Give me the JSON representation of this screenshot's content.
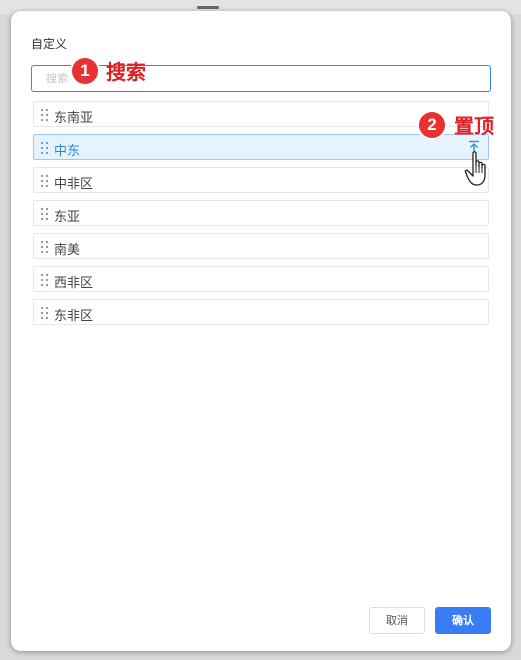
{
  "dialog": {
    "title": "自定义",
    "search": {
      "placeholder": "搜索",
      "value": ""
    },
    "items": [
      {
        "label": "东南亚",
        "active": false
      },
      {
        "label": "中东",
        "active": true
      },
      {
        "label": "中非区",
        "active": false
      },
      {
        "label": "东亚",
        "active": false
      },
      {
        "label": "南美",
        "active": false
      },
      {
        "label": "西非区",
        "active": false
      },
      {
        "label": "东非区",
        "active": false
      }
    ],
    "cancel_label": "取消",
    "confirm_label": "确认"
  },
  "annotations": {
    "step1": {
      "number": "1",
      "text": "搜索"
    },
    "step2": {
      "number": "2",
      "text": "置顶"
    }
  },
  "colors": {
    "accent": "#3a7cf5",
    "active_bg": "#e6f3fc",
    "active_text": "#2e86d6",
    "callout_red": "#e83232"
  },
  "icons": {
    "drag_handle": "drag-handle-icon",
    "pin_top": "pin-to-top-icon",
    "cursor": "hand-pointer-icon"
  }
}
